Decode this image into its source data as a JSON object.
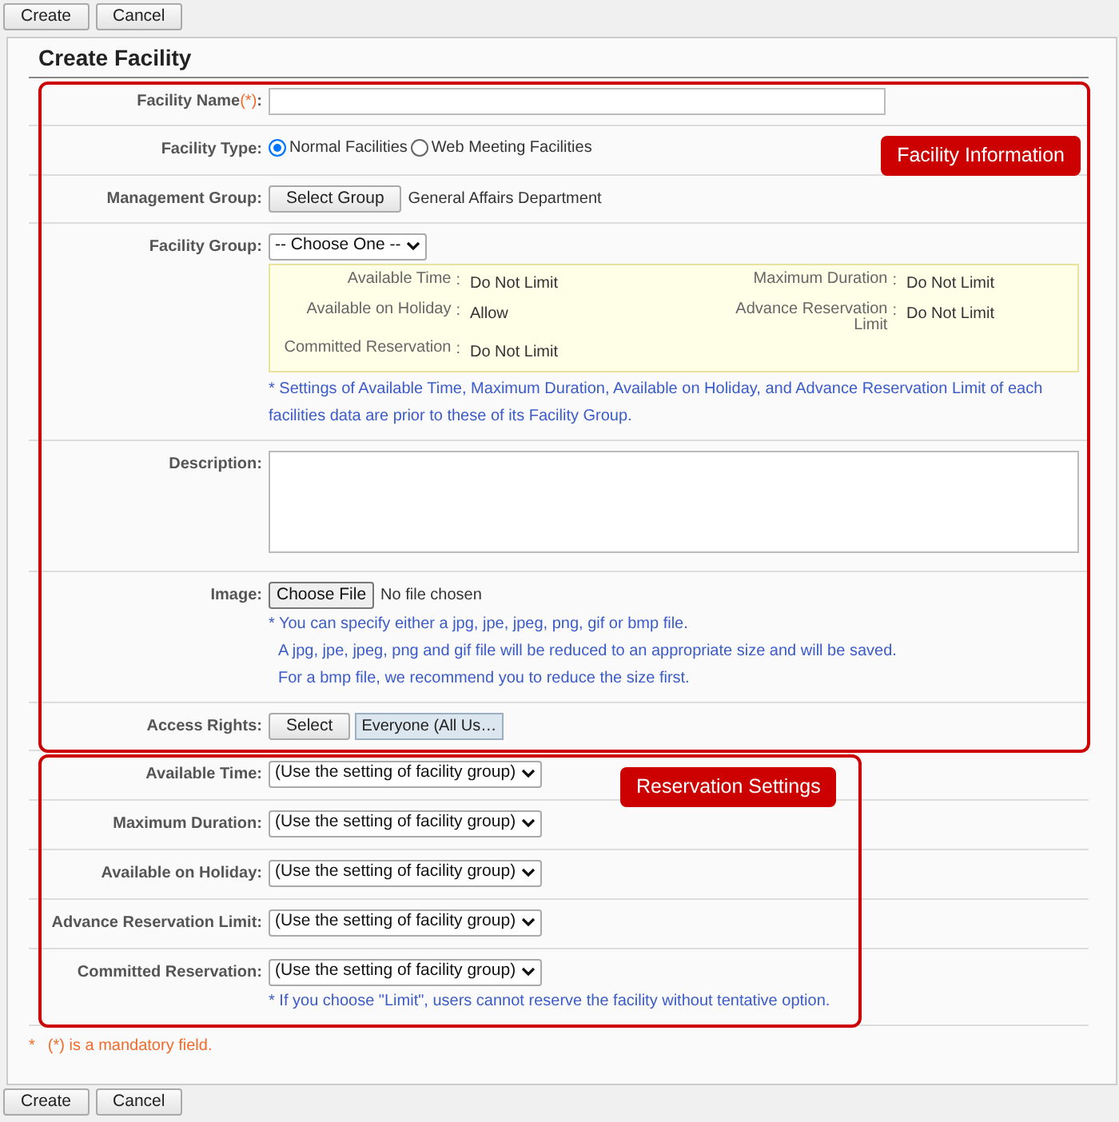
{
  "toolbar_top": {
    "buttons": [
      "Create",
      "Cancel"
    ]
  },
  "title": "Create Facility",
  "sections": [
    {
      "callout": "Facility Information",
      "fields": [
        {
          "kind": "text",
          "label": "Facility Name",
          "required_mark": "(*)",
          "colon": ":"
        },
        {
          "kind": "radio",
          "label": "Facility Type",
          "colon": ":",
          "options": [
            {
              "label": "Normal Facilities",
              "selected": true
            },
            {
              "label": "Web Meeting Facilities",
              "selected": false
            }
          ]
        },
        {
          "kind": "picker",
          "label": "Management Group",
          "colon": ":",
          "button": "Select Group",
          "value": "General Affairs Department"
        },
        {
          "kind": "group",
          "label": "Facility Group",
          "colon": ":",
          "select": "-- Choose One --",
          "info": [
            {
              "label": "Available Time",
              "colon": ":",
              "value": "Do Not Limit"
            },
            {
              "label": "Maximum Duration",
              "colon": ":",
              "value": "Do Not Limit"
            },
            {
              "label": "Available on Holiday",
              "colon": ":",
              "value": "Allow"
            },
            {
              "label": "Advance Reservation Limit",
              "colon": ":",
              "value": "Do Not Limit"
            },
            {
              "label": "Committed Reservation",
              "colon": ":",
              "value": "Do Not Limit"
            }
          ],
          "notes": [
            "* Settings of Available Time, Maximum Duration, Available on Holiday, and Advance Reservation Limit of each facilities data are prior to these of its Facility Group."
          ]
        },
        {
          "kind": "textarea",
          "label": "Description",
          "colon": ":"
        },
        {
          "kind": "file",
          "label": "Image",
          "colon": ":",
          "button": "Choose File",
          "value": "No file chosen",
          "notes": [
            "* You can specify either a jpg, jpe, jpeg, png, gif or bmp file.",
            "A jpg, jpe, jpeg, png and gif file will be reduced to an appropriate size and will be saved.",
            "For a bmp file, we recommend you to reduce the size first."
          ]
        },
        {
          "kind": "access",
          "label": "Access Rights",
          "colon": ":",
          "button": "Select",
          "value": "Everyone (All Us…"
        }
      ]
    },
    {
      "callout": "Reservation Settings",
      "fields": [
        {
          "kind": "select",
          "label": "Available Time",
          "colon": ":",
          "value": "(Use the setting of facility group)"
        },
        {
          "kind": "select",
          "label": "Maximum Duration",
          "colon": ":",
          "value": "(Use the setting of facility group)"
        },
        {
          "kind": "select",
          "label": "Available on Holiday",
          "colon": ":",
          "value": "(Use the setting of facility group)"
        },
        {
          "kind": "select",
          "label": "Advance Reservation Limit",
          "colon": ":",
          "value": "(Use the setting of facility group)"
        },
        {
          "kind": "select",
          "label": "Committed Reservation",
          "colon": ":",
          "value": "(Use the setting of facility group)",
          "notes": [
            "* If you choose \"Limit\", users cannot reserve the facility without tentative option."
          ]
        }
      ]
    }
  ],
  "footnote": {
    "mark": "*",
    "text": "(*) is a mandatory field."
  },
  "toolbar_bottom": {
    "buttons": [
      "Create",
      "Cancel"
    ]
  }
}
